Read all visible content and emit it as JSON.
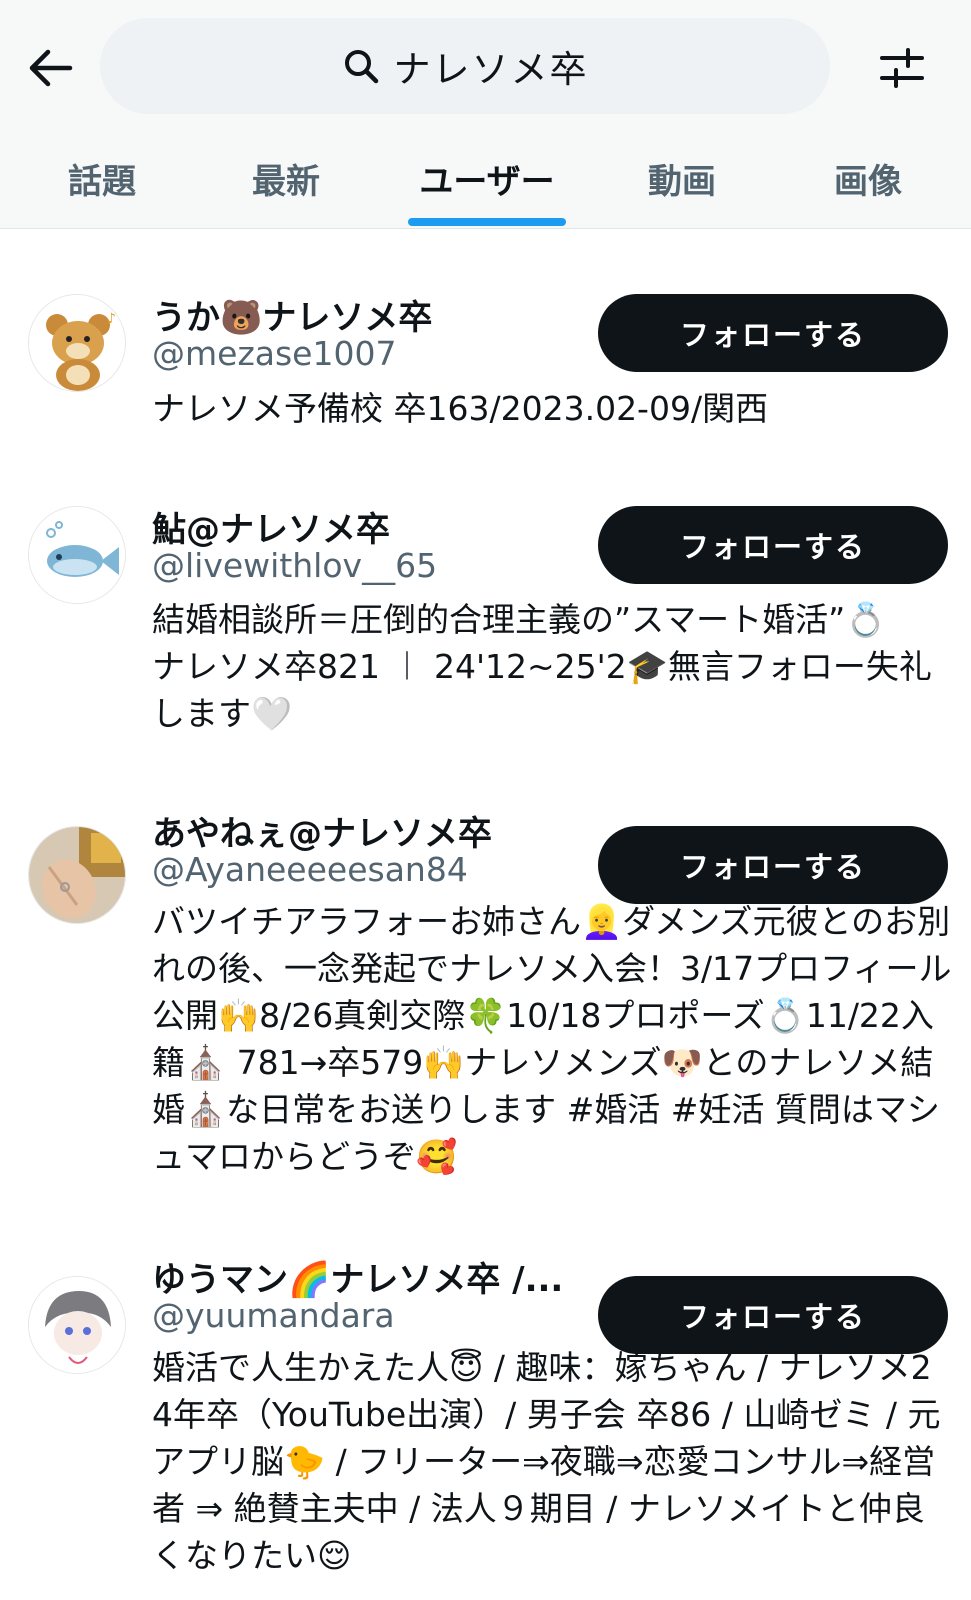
{
  "search": {
    "query": "ナレソメ卒",
    "icon": "search-icon"
  },
  "tabs": [
    {
      "label": "話題"
    },
    {
      "label": "最新"
    },
    {
      "label": "ユーザー",
      "active": true
    },
    {
      "label": "動画"
    },
    {
      "label": "画像"
    }
  ],
  "follow_label": "フォローする",
  "users": [
    {
      "name": "うか🐻ナレソメ卒",
      "handle": "@mezase1007",
      "bio": "ナレソメ予備校 卒163/2023.02-09/関西"
    },
    {
      "name": "鮎@ナレソメ卒",
      "handle": "@livewithlov__65",
      "bio": "結婚相談所＝圧倒的合理主義の”スマート婚活”💍\nナレソメ卒821 ︱ 24'12~25'2🎓無言フォロー失礼します🤍"
    },
    {
      "name": "あやねぇ@ナレソメ卒",
      "handle": "@Ayaneeeeesan84",
      "bio": "バツイチアラフォーお姉さん👱‍♀️ダメンズ元彼とのお別れの後、一念発起でナレソメ入会！3/17プロフィール公開🙌8/26真剣交際🍀10/18プロポーズ💍11/22入籍⛪ 781→卒579🙌ナレソメンズ🐶とのナレソメ結婚⛪な日常をお送りします #婚活 #妊活 質問はマシュマロからどうぞ🥰"
    },
    {
      "name": "ゆうマン🌈ナレソメ卒 /...",
      "handle": "@yuumandara",
      "bio": "婚活で人生かえた人😇 / 趣味：嫁ちゃん / ナレソメ24年卒（YouTube出演）/ 男子会 卒86 / 山崎ゼミ / 元アプリ脳🐤 / フリーター⇒夜職⇒恋愛コンサル⇒経営者 ⇒ 絶賛主夫中 / 法人９期目 / ナレソメイトと仲良くなりたい😌"
    }
  ]
}
